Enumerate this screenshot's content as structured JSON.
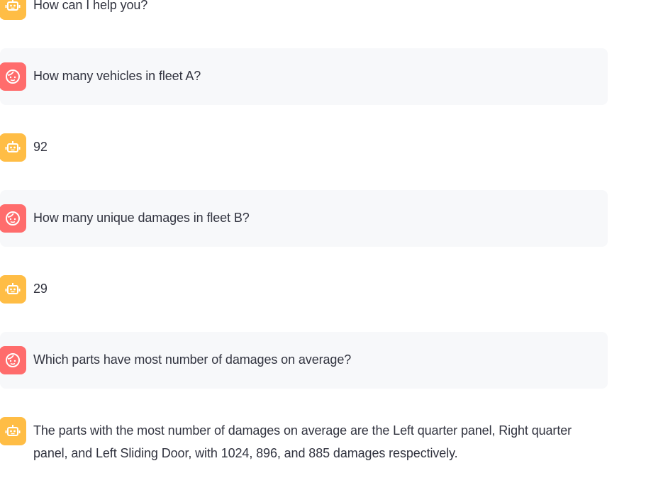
{
  "messages": [
    {
      "role": "assistant",
      "avatar_icon": "robot-icon",
      "text": "How can I help you?"
    },
    {
      "role": "user",
      "avatar_icon": "user-face-icon",
      "text": "How many vehicles in fleet A?"
    },
    {
      "role": "assistant",
      "avatar_icon": "robot-icon",
      "text": "92"
    },
    {
      "role": "user",
      "avatar_icon": "user-face-icon",
      "text": "How many unique damages in fleet B?"
    },
    {
      "role": "assistant",
      "avatar_icon": "robot-icon",
      "text": "29"
    },
    {
      "role": "user",
      "avatar_icon": "user-face-icon",
      "text": "Which parts have most number of damages on average?"
    },
    {
      "role": "assistant",
      "avatar_icon": "robot-icon",
      "text": "The parts with the most number of damages on average are the Left quarter panel, Right quarter panel, and Left Sliding Door, with 1024, 896, and 885 damages respectively."
    }
  ],
  "colors": {
    "assistant_avatar": "#ffbd45",
    "user_avatar": "#ff6c6c",
    "user_bubble": "#f7f8fa",
    "text": "#31333f"
  }
}
